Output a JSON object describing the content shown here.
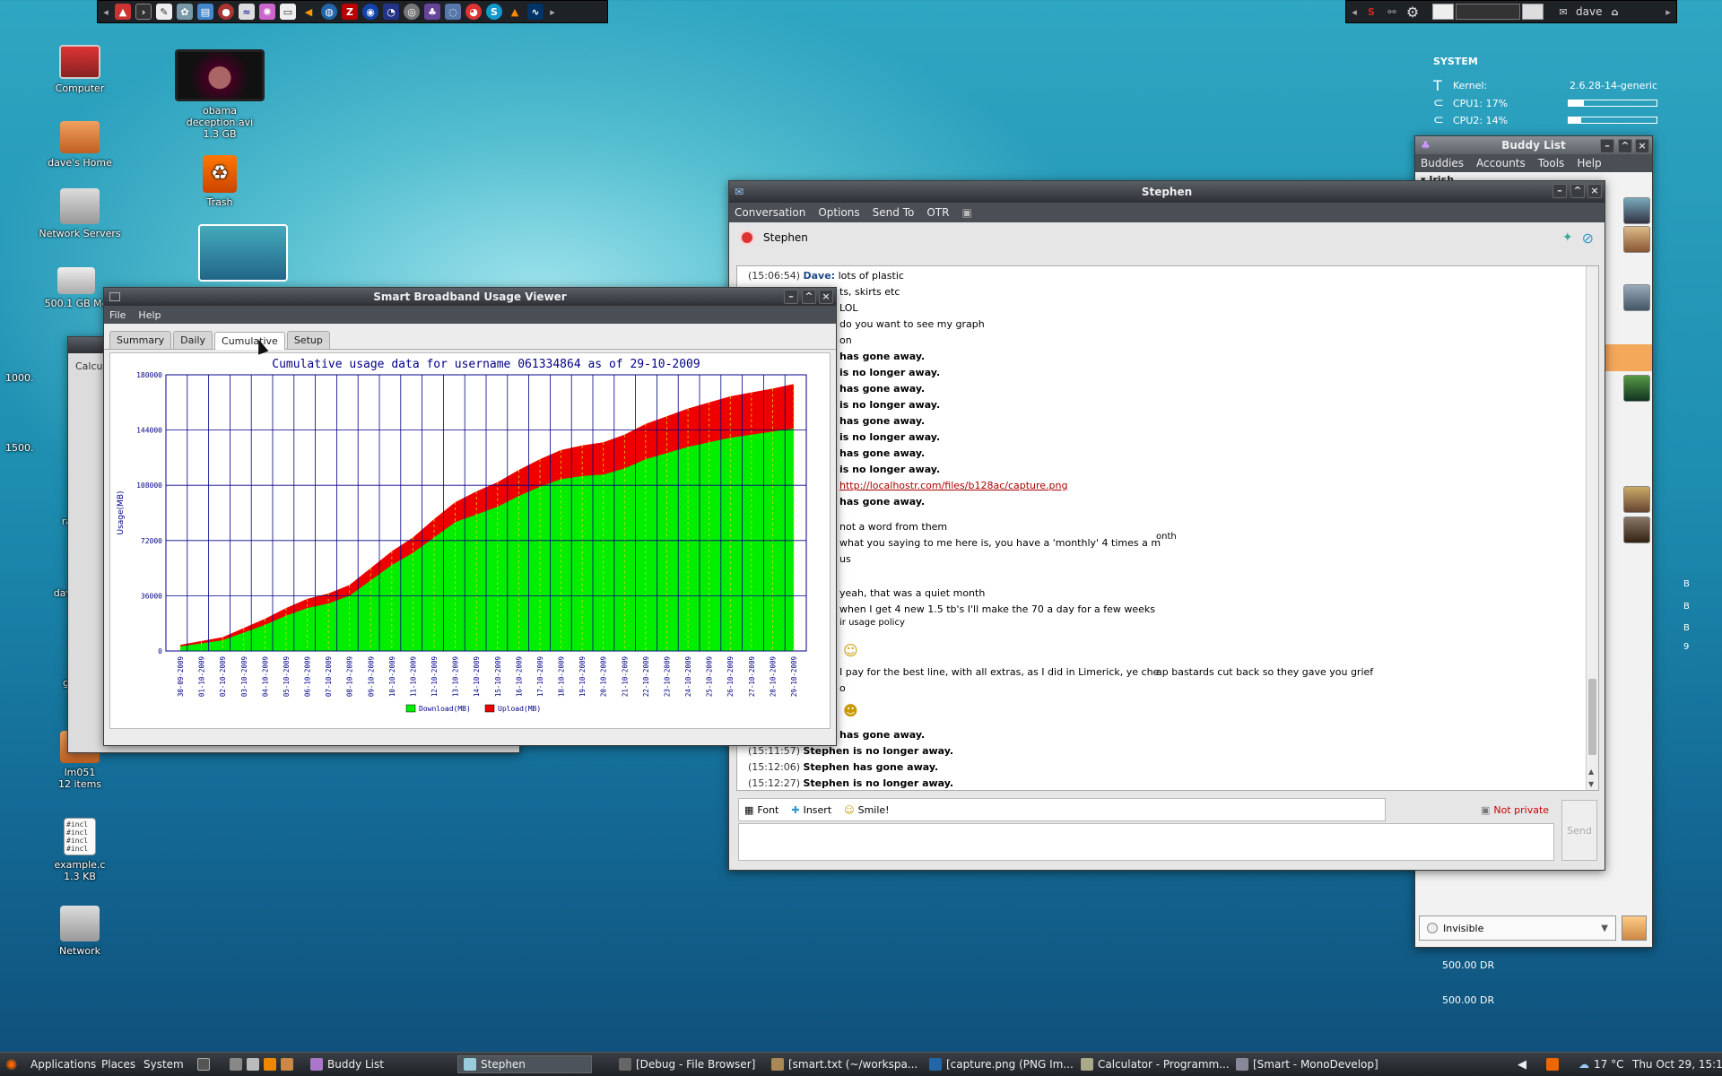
{
  "desktop": {
    "icons": [
      {
        "label": "Computer",
        "sub": ""
      },
      {
        "label": "obama deception.avi",
        "sub": "1.3 GB"
      },
      {
        "label": "dave's Home",
        "sub": ""
      },
      {
        "label": "Trash",
        "sub": ""
      },
      {
        "label": "Network Servers",
        "sub": ""
      },
      {
        "label": "500.1 GB Me",
        "sub": ""
      },
      {
        "label": "1000.",
        "sub": ""
      },
      {
        "label": "1500.",
        "sub": ""
      },
      {
        "label": "ra",
        "sub": ""
      },
      {
        "label": "dav",
        "sub": ""
      },
      {
        "label": "gl",
        "sub": ""
      },
      {
        "label": "lm051",
        "sub": "12 items"
      },
      {
        "label": "example.c",
        "sub": "1.3 KB"
      },
      {
        "label": "Network",
        "sub": ""
      }
    ],
    "bg_window_label": "Calcu"
  },
  "top_panel": {
    "user": "dave"
  },
  "conky": {
    "header": "SYSTEM",
    "kernel_label": "Kernel:",
    "kernel_value": "2.6.28-14-generic",
    "cpu1": "CPU1: 17%",
    "cpu1_pct": 0.17,
    "cpu2": "CPU2: 14%",
    "cpu2_pct": 0.14,
    "disk1": "500.00 DR",
    "disk2": "500.00 DR",
    "side_letters": [
      "B",
      "B",
      "B",
      "9"
    ]
  },
  "buddy_list": {
    "title": "Buddy List",
    "menu": [
      "Buddies",
      "Accounts",
      "Tools",
      "Help"
    ],
    "group": "Irish",
    "status": "Invisible"
  },
  "conversation": {
    "title": "Stephen",
    "menu": [
      "Conversation",
      "Options",
      "Send To",
      "OTR"
    ],
    "buddy_name": "Stephen",
    "lines": [
      {
        "ts": "(15:06:54)",
        "nick": "Dave:",
        "text": "lots of plastic",
        "bold": false
      },
      {
        "ts": "",
        "nick": "",
        "text": "ts, skirts etc",
        "bold": false
      },
      {
        "ts": "",
        "nick": "",
        "text": "LOL",
        "bold": false
      },
      {
        "ts": "",
        "nick": "",
        "text": "do you want to see my graph",
        "bold": false
      },
      {
        "ts": "",
        "nick": "",
        "text": "on",
        "bold": false
      },
      {
        "ts": "",
        "nick": "",
        "text": "has gone away.",
        "bold": true
      },
      {
        "ts": "",
        "nick": "",
        "text": "is no longer away.",
        "bold": true
      },
      {
        "ts": "",
        "nick": "",
        "text": "has gone away.",
        "bold": true
      },
      {
        "ts": "",
        "nick": "",
        "text": "is no longer away.",
        "bold": true
      },
      {
        "ts": "",
        "nick": "",
        "text": "has gone away.",
        "bold": true
      },
      {
        "ts": "",
        "nick": "",
        "text": "is no longer away.",
        "bold": true
      },
      {
        "ts": "",
        "nick": "",
        "text": "has gone away.",
        "bold": true
      },
      {
        "ts": "",
        "nick": "",
        "text": "is no longer away.",
        "bold": true
      }
    ],
    "link": "http://localhostr.com/files/b128ac/capture.png",
    "lines2": [
      {
        "text": "has gone away.",
        "bold": true
      },
      {
        "text": "not a word from them",
        "bold": false
      },
      {
        "text": "what you saying to me here is, you have a 'monthly' 4 times a m",
        "bold": false
      },
      {
        "text": "us",
        "bold": false
      },
      {
        "text": "yeah, that was a quiet month",
        "bold": false
      },
      {
        "text": "when I get 4 new 1.5 tb's I'll make the 70 a day for a few weeks",
        "bold": false
      },
      {
        "text": "ir usage policy",
        "bold": false
      },
      {
        "text": "I pay for the best line, with all extras, as I did in Limerick, ye che",
        "bold": false
      },
      {
        "text": "o",
        "bold": false
      },
      {
        "text": "has gone away.",
        "bold": true
      }
    ],
    "month_overlay": "onth",
    "cheap_overlay": "ap bastards cut back so they gave you grief",
    "status_lines": [
      {
        "ts": "(15:11:57)",
        "text": "Stephen is no longer away."
      },
      {
        "ts": "(15:12:06)",
        "text": "Stephen has gone away."
      },
      {
        "ts": "(15:12:27)",
        "text": "Stephen is no longer away."
      }
    ],
    "toolbar": {
      "font": "Font",
      "insert": "Insert",
      "smile": "Smile!",
      "otr": "Not private",
      "send": "Send"
    }
  },
  "usage_viewer": {
    "title": "Smart Broadband Usage Viewer",
    "menu": [
      "File",
      "Help"
    ],
    "tabs": [
      "Summary",
      "Daily",
      "Cumulative",
      "Setup"
    ],
    "active_tab": "Cumulative"
  },
  "chart_data": {
    "type": "area",
    "title": "Cumulative usage data for username 061334864 as of 29-10-2009",
    "ylabel": "Usage(MB)",
    "xlabel": "",
    "ylim": [
      0,
      180000
    ],
    "yticks": [
      0,
      36000,
      72000,
      108000,
      144000,
      180000
    ],
    "categories": [
      "30-09-2009",
      "01-10-2009",
      "02-10-2009",
      "03-10-2009",
      "04-10-2009",
      "05-10-2009",
      "06-10-2009",
      "07-10-2009",
      "08-10-2009",
      "09-10-2009",
      "10-10-2009",
      "11-10-2009",
      "12-10-2009",
      "13-10-2009",
      "14-10-2009",
      "15-10-2009",
      "16-10-2009",
      "17-10-2009",
      "18-10-2009",
      "19-10-2009",
      "20-10-2009",
      "21-10-2009",
      "22-10-2009",
      "23-10-2009",
      "24-10-2009",
      "25-10-2009",
      "26-10-2009",
      "27-10-2009",
      "28-10-2009",
      "29-10-2009"
    ],
    "series": [
      {
        "name": "Download(MB)",
        "color": "#00ee00",
        "values": [
          3000,
          5000,
          7000,
          12000,
          17000,
          23000,
          28000,
          31000,
          36000,
          46000,
          56000,
          64000,
          74000,
          84000,
          89000,
          94000,
          101000,
          107000,
          112000,
          114000,
          115000,
          119000,
          125000,
          129000,
          133000,
          136000,
          139000,
          141000,
          143000,
          145000
        ]
      },
      {
        "name": "Upload(MB)",
        "color": "#ee0000",
        "values": [
          1000,
          1500,
          2000,
          3000,
          4000,
          5000,
          6000,
          6500,
          7000,
          8000,
          9000,
          10000,
          12000,
          13000,
          15000,
          16000,
          17000,
          18000,
          19000,
          20000,
          21000,
          22000,
          23000,
          24000,
          25000,
          26000,
          27000,
          27500,
          28000,
          29000
        ]
      }
    ],
    "stacked": true,
    "grid": true,
    "legend": "bottom"
  },
  "taskbar": {
    "menus": [
      "Applications",
      "Places",
      "System"
    ],
    "tasks": [
      "Buddy List",
      "Stephen",
      "[Debug - File Browser]",
      "[smart.txt (~/workspa...",
      "[capture.png (PNG Im...",
      "Calculator - Programm...",
      "[Smart - MonoDevelop]"
    ],
    "weather": "17 °C",
    "clock": "Thu Oct 29, 15:12"
  }
}
